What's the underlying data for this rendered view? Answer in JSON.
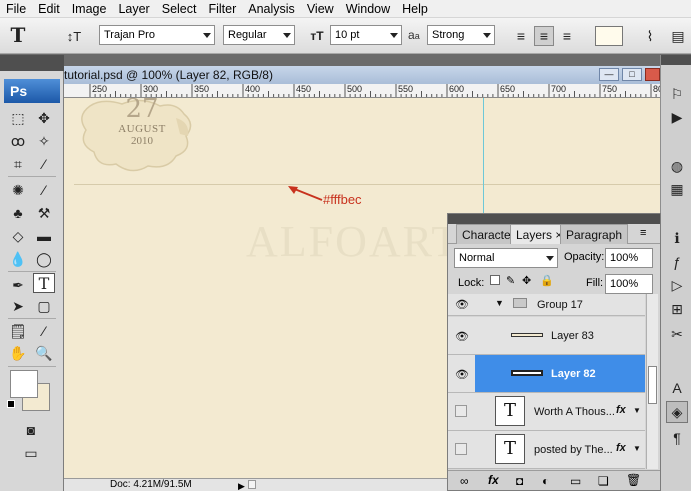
{
  "menu": [
    "File",
    "Edit",
    "Image",
    "Layer",
    "Select",
    "Filter",
    "Analysis",
    "View",
    "Window",
    "Help"
  ],
  "options": {
    "font_family": "Trajan Pro",
    "font_style": "Regular",
    "font_size": "10 pt",
    "aa_label": "a",
    "aa_label2": "a",
    "antialias": "Strong"
  },
  "tools": {
    "logo": "Ps"
  },
  "document": {
    "title": "tutorial.psd @ 100% (Layer 82, RGB/8)",
    "ruler_ticks": [
      "250",
      "300",
      "350",
      "400",
      "450",
      "500",
      "550",
      "600",
      "650",
      "700",
      "750",
      "800"
    ],
    "status": "Doc: 4.21M/91.5M"
  },
  "canvas": {
    "date_day": "27",
    "date_month": "AUGUST",
    "date_year": "2010",
    "watermark": "ALFOART",
    "annotation": "#fffbec",
    "annotation_color": "#c8321e"
  },
  "layers_panel": {
    "tabs": [
      "Character",
      "Layers",
      "Paragraph"
    ],
    "blend_mode": "Normal",
    "opacity_label": "Opacity:",
    "opacity_value": "100%",
    "lock_label": "Lock:",
    "fill_label": "Fill:",
    "fill_value": "100%",
    "layers": [
      {
        "name": "Group 17",
        "type": "group"
      },
      {
        "name": "Layer 83",
        "type": "layer"
      },
      {
        "name": "Layer 82",
        "type": "layer",
        "selected": true
      },
      {
        "name": "Worth A Thous...",
        "type": "text",
        "fx": "fx"
      },
      {
        "name": "posted by The...",
        "type": "text",
        "fx": "fx"
      }
    ],
    "text_thumb": "T"
  },
  "colors": {
    "canvas_bg": "#f3ead1",
    "selection": "#3f8de8",
    "accent_blue": "#1c58a8"
  }
}
